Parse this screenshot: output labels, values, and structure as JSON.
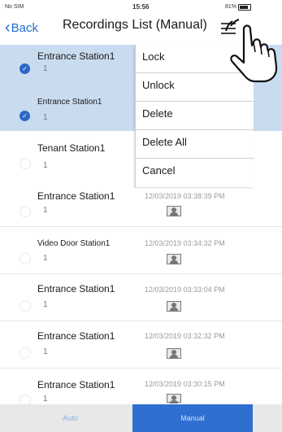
{
  "status_bar": {
    "carrier": "No SIM",
    "time": "15:56",
    "battery": "81%"
  },
  "nav": {
    "back_label": "Back",
    "title": "Recordings List (Manual)"
  },
  "recordings": [
    {
      "name": "Entrance Station1",
      "number": "1",
      "selected": true,
      "datetime": "",
      "has_thumb": false
    },
    {
      "name": "Entrance Station1",
      "number": "1",
      "selected": true,
      "datetime": "",
      "has_thumb": false
    },
    {
      "name": "Tenant Station1",
      "number": "1",
      "selected": false,
      "datetime": "",
      "has_thumb": false
    },
    {
      "name": "Entrance Station1",
      "number": "1",
      "selected": false,
      "datetime": "12/03/2019 03:38:39 PM",
      "has_thumb": true
    },
    {
      "name": "Video Door Station1",
      "number": "1",
      "selected": false,
      "datetime": "12/03/2019 03:34:32 PM",
      "has_thumb": true
    },
    {
      "name": "Entrance Station1",
      "number": "1",
      "selected": false,
      "datetime": "12/03/2019 03:33:04 PM",
      "has_thumb": true
    },
    {
      "name": "Entrance Station1",
      "number": "1",
      "selected": false,
      "datetime": "12/03/2019 03:32:32 PM",
      "has_thumb": true
    },
    {
      "name": "Entrance Station1",
      "number": "1",
      "selected": false,
      "datetime": "12/03/2019 03:30:15 PM",
      "has_thumb": true
    }
  ],
  "menu": {
    "items": [
      "Lock",
      "Unlock",
      "Delete",
      "Delete All",
      "Cancel"
    ]
  },
  "tabs": {
    "auto": "Auto",
    "manual": "Manual"
  },
  "colors": {
    "accent": "#2f6fd0",
    "selected_row": "#c9dbef",
    "back_link": "#1e6fce"
  }
}
